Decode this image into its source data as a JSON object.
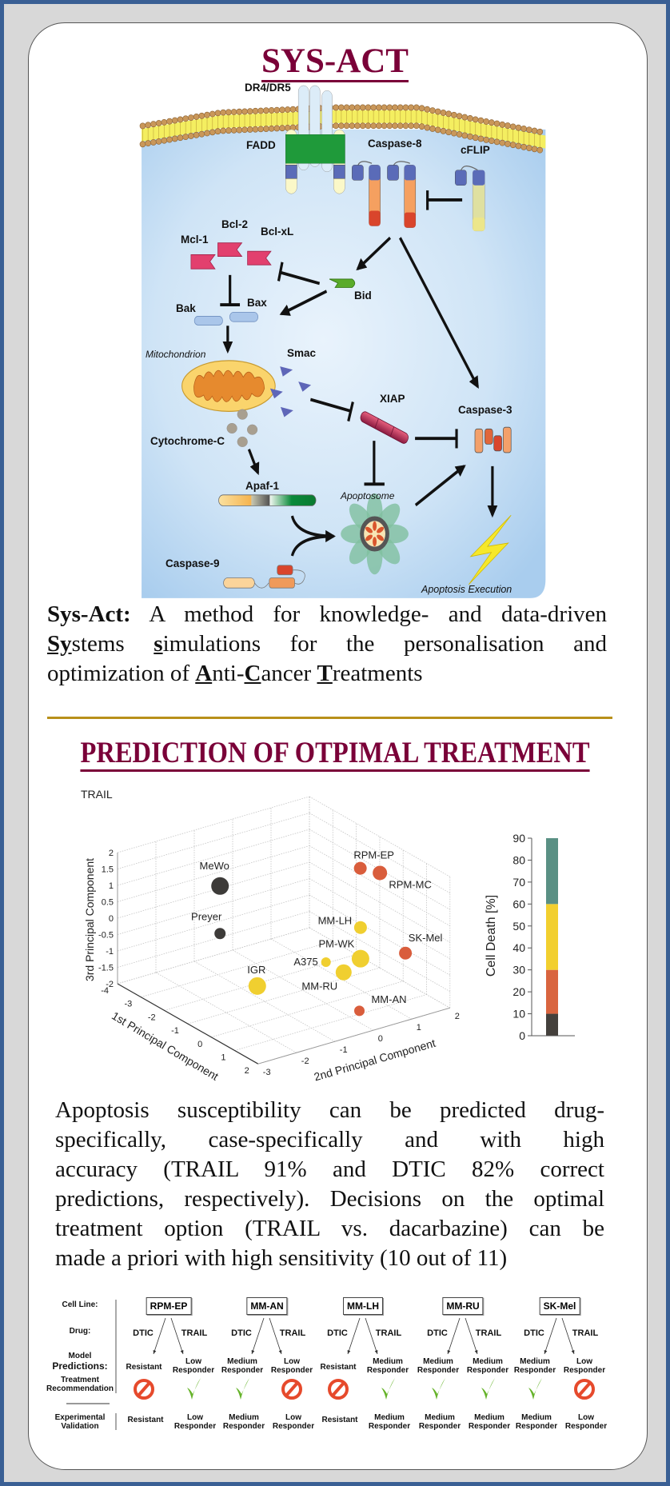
{
  "header": {
    "title": "SYS-ACT"
  },
  "pathway": {
    "labels": {
      "dr4_dr5": "DR4/DR5",
      "fadd": "FADD",
      "caspase8": "Caspase-8",
      "cflip": "cFLIP",
      "bcl2": "Bcl-2",
      "bclxl": "Bcl-xL",
      "mcl1": "Mcl-1",
      "bid": "Bid",
      "bak": "Bak",
      "bax": "Bax",
      "mitochondrion": "Mitochondrion",
      "smac": "Smac",
      "xiap": "XIAP",
      "caspase3": "Caspase-3",
      "cytochrome_c": "Cytochrome-C",
      "apaf1": "Apaf-1",
      "apoptosome": "Apoptosome",
      "caspase9": "Caspase-9",
      "apoptosis_execution": "Apoptosis Execution"
    }
  },
  "intro": {
    "lines": [
      [
        {
          "t": "Sys-Act:",
          "s": "b"
        },
        {
          "t": " A method for knowledge- and data-driven",
          "s": ""
        }
      ],
      [
        {
          "t": "Sy",
          "s": "bu"
        },
        {
          "t": "stems ",
          "s": ""
        },
        {
          "t": "s",
          "s": "bu"
        },
        {
          "t": "imulations for the personalisation and",
          "s": ""
        }
      ],
      [
        {
          "t": "optimization of ",
          "s": ""
        },
        {
          "t": "A",
          "s": "bu"
        },
        {
          "t": "nti-",
          "s": ""
        },
        {
          "t": "C",
          "s": "bu"
        },
        {
          "t": "ancer ",
          "s": ""
        },
        {
          "t": "T",
          "s": "bu"
        },
        {
          "t": "reatments",
          "s": ""
        }
      ]
    ]
  },
  "section2": {
    "title": "PREDICTION OF OTPIMAL TREATMENT"
  },
  "chart_data": {
    "type": "scatter3d",
    "title": "TRAIL",
    "xlabel": "1st Principal Component",
    "ylabel": "2nd Principal Component",
    "zlabel": "3rd Principal Component",
    "xlim": [
      -4,
      2
    ],
    "ylim": [
      -3,
      2
    ],
    "zlim": [
      -2,
      2
    ],
    "xticks": [
      -4,
      -3,
      -2,
      -1,
      0,
      1,
      2
    ],
    "yticks": [
      -3,
      -2,
      -1,
      0,
      1,
      2
    ],
    "zticks": [
      -2,
      -1.5,
      -1,
      -0.5,
      0,
      0.5,
      1,
      1.5,
      2
    ],
    "grid": true,
    "points": [
      {
        "name": "MeWo",
        "x": -2,
        "y": -1.55,
        "z": 1.3,
        "color": "#3d3b39"
      },
      {
        "name": "Preyer",
        "x": -2,
        "y": -1.55,
        "z": -0.15,
        "color": "#3d3b39"
      },
      {
        "name": "IGR",
        "x": 0,
        "y": -1.8,
        "z": -0.85,
        "color": "#f0cf30"
      },
      {
        "name": "A375",
        "x": -1,
        "y": 0.6,
        "z": -1.35,
        "color": "#f0cf30"
      },
      {
        "name": "MM-RU",
        "x": 0,
        "y": 0.45,
        "z": -1.2,
        "color": "#f0cf30"
      },
      {
        "name": "PM-WK",
        "x": -1,
        "y": 1.5,
        "z": -1.55,
        "color": "#f0cf30"
      },
      {
        "name": "MM-LH",
        "x": -1,
        "y": 1.5,
        "z": -0.6,
        "color": "#f0cf30"
      },
      {
        "name": "SK-Mel",
        "x": 1,
        "y": 1.45,
        "z": -0.55,
        "color": "#d95d3c"
      },
      {
        "name": "RPM-EP",
        "x": -1.5,
        "y": 1.8,
        "z": 0.9,
        "color": "#d95d3c"
      },
      {
        "name": "RPM-MC",
        "x": -0.5,
        "y": 1.7,
        "z": 1.2,
        "color": "#d95d3c"
      },
      {
        "name": "MM-AN",
        "x": 1,
        "y": 0.25,
        "z": -1.9,
        "color": "#d95d3c"
      }
    ],
    "colorbar": {
      "label": "Cell Death [%]",
      "range": [
        0,
        90
      ],
      "ticks": [
        0,
        10,
        20,
        30,
        40,
        50,
        60,
        70,
        80,
        90
      ],
      "bins": [
        {
          "from": 0,
          "to": 10,
          "color": "#44403c"
        },
        {
          "from": 10,
          "to": 30,
          "color": "#d9653f"
        },
        {
          "from": 30,
          "to": 60,
          "color": "#f2cf2f"
        },
        {
          "from": 60,
          "to": 90,
          "color": "#5a9084"
        }
      ]
    }
  },
  "summary": {
    "lines": [
      "Apoptosis susceptibility can be predicted drug-",
      "specifically, case-specifically and with high",
      "accuracy (TRAIL 91% and DTIC 82% correct",
      "predictions, respectively). Decisions on the optimal",
      "treatment option (TRAIL vs. dacarbazine) can be",
      "made a priori with high sensitivity (10 out of 11)"
    ]
  },
  "validation": {
    "row_labels": {
      "cell_line": "Cell Line:",
      "drug": "Drug:",
      "model": "Model",
      "predictions": "Predictions:",
      "treatment": "Treatment",
      "recommendation": "Recommendation",
      "experimental": "Experimental",
      "validation": "Validation"
    },
    "icon_colors": {
      "recommended": "#66b32a",
      "not_recommended": "#e64a2c"
    },
    "columns": [
      {
        "cell_line": "RPM-EP",
        "dtic": {
          "drug": "DTIC",
          "prediction": [
            "Resistant"
          ],
          "recommended": false,
          "validation": [
            "Resistant"
          ]
        },
        "trail": {
          "drug": "TRAIL",
          "prediction": [
            "Low",
            "Responder"
          ],
          "recommended": true,
          "validation": [
            "Low",
            "Responder"
          ]
        }
      },
      {
        "cell_line": "MM-AN",
        "dtic": {
          "drug": "DTIC",
          "prediction": [
            "Medium",
            "Responder"
          ],
          "recommended": true,
          "validation": [
            "Medium",
            "Responder"
          ]
        },
        "trail": {
          "drug": "TRAIL",
          "prediction": [
            "Low",
            "Responder"
          ],
          "recommended": false,
          "validation": [
            "Low",
            "Responder"
          ]
        }
      },
      {
        "cell_line": "MM-LH",
        "dtic": {
          "drug": "DTIC",
          "prediction": [
            "Resistant"
          ],
          "recommended": false,
          "validation": [
            "Resistant"
          ]
        },
        "trail": {
          "drug": "TRAIL",
          "prediction": [
            "Medium",
            "Responder"
          ],
          "recommended": true,
          "validation": [
            "Medium",
            "Responder"
          ]
        }
      },
      {
        "cell_line": "MM-RU",
        "dtic": {
          "drug": "DTIC",
          "prediction": [
            "Medium",
            "Responder"
          ],
          "recommended": true,
          "validation": [
            "Medium",
            "Responder"
          ]
        },
        "trail": {
          "drug": "TRAIL",
          "prediction": [
            "Medium",
            "Responder"
          ],
          "recommended": true,
          "validation": [
            "Medium",
            "Responder"
          ]
        }
      },
      {
        "cell_line": "SK-Mel",
        "dtic": {
          "drug": "DTIC",
          "prediction": [
            "Medium",
            "Responder"
          ],
          "recommended": true,
          "validation": [
            "Medium",
            "Responder"
          ]
        },
        "trail": {
          "drug": "TRAIL",
          "prediction": [
            "Low",
            "Responder"
          ],
          "recommended": false,
          "validation": [
            "Low",
            "Responder"
          ]
        }
      }
    ]
  }
}
